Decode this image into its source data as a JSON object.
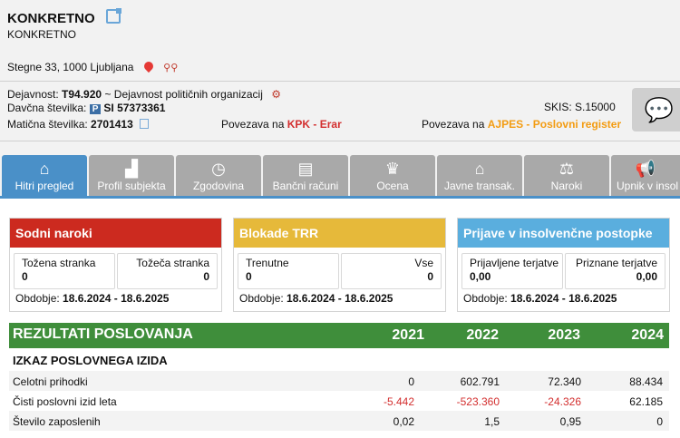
{
  "company": {
    "name": "KONKRETNO",
    "subname": "KONKRETNO",
    "address": "Stegne 33, 1000 Ljubljana"
  },
  "details": {
    "activity_label": "Dejavnost:",
    "activity_code": "T94.920",
    "activity_desc": "~ Dejavnost političnih organizacij",
    "tax_label": "Davčna številka:",
    "tax_badge": "P",
    "tax_value": "SI 57373361",
    "reg_label": "Matična številka:",
    "reg_value": "2701413",
    "kpk_prefix": "Povezava na",
    "kpk_link": "KPK - Erar",
    "ajpes_prefix": "Povezava na",
    "ajpes_link": "AJPES - Poslovni register",
    "skis_label": "SKIS:",
    "skis_value": "S.15000"
  },
  "tabs": [
    {
      "label": "Hitri pregled",
      "icon": "home-icon"
    },
    {
      "label": "Profil subjekta",
      "icon": "factory-icon"
    },
    {
      "label": "Zgodovina",
      "icon": "clock-icon"
    },
    {
      "label": "Bančni računi",
      "icon": "card-icon"
    },
    {
      "label": "Ocena",
      "icon": "trophy-icon"
    },
    {
      "label": "Javne transak.",
      "icon": "bank-icon"
    },
    {
      "label": "Naroki",
      "icon": "scales-icon"
    },
    {
      "label": "Upnik v insol",
      "icon": "megaphone-icon"
    }
  ],
  "cards": {
    "sodni": {
      "title": "Sodni naroki",
      "color": "#cc2a1f",
      "left_label": "Tožena stranka",
      "left_value": "0",
      "right_label": "Tožeča stranka",
      "right_value": "0",
      "period_label": "Obdobje:",
      "period_value": "18.6.2024 - 18.6.2025"
    },
    "blokade": {
      "title": "Blokade TRR",
      "color": "#e6b93a",
      "left_label": "Trenutne",
      "left_value": "0",
      "right_label": "Vse",
      "right_value": "0",
      "period_label": "Obdobje:",
      "period_value": "18.6.2024 - 18.6.2025"
    },
    "insolv": {
      "title": "Prijave v insolvenčne postopke",
      "color": "#5aaede",
      "left_label": "Prijavljene terjatve",
      "left_value": "0,00",
      "right_label": "Priznane terjatve",
      "right_value": "0,00",
      "period_label": "Obdobje:",
      "period_value": "18.6.2024 - 18.6.2025"
    }
  },
  "results": {
    "title": "REZULTATI POSLOVANJA",
    "years": [
      "2021",
      "2022",
      "2023",
      "2024"
    ],
    "section": "IZKAZ POSLOVNEGA IZIDA",
    "rows": [
      {
        "label": "Celotni prihodki",
        "values": [
          "0",
          "602.791",
          "72.340",
          "88.434"
        ]
      },
      {
        "label": "Čisti poslovni izid leta",
        "values": [
          "-5.442",
          "-523.360",
          "-24.326",
          "62.185"
        ]
      },
      {
        "label": "Število zaposlenih",
        "values": [
          "0,02",
          "1,5",
          "0,95",
          "0"
        ]
      }
    ]
  }
}
